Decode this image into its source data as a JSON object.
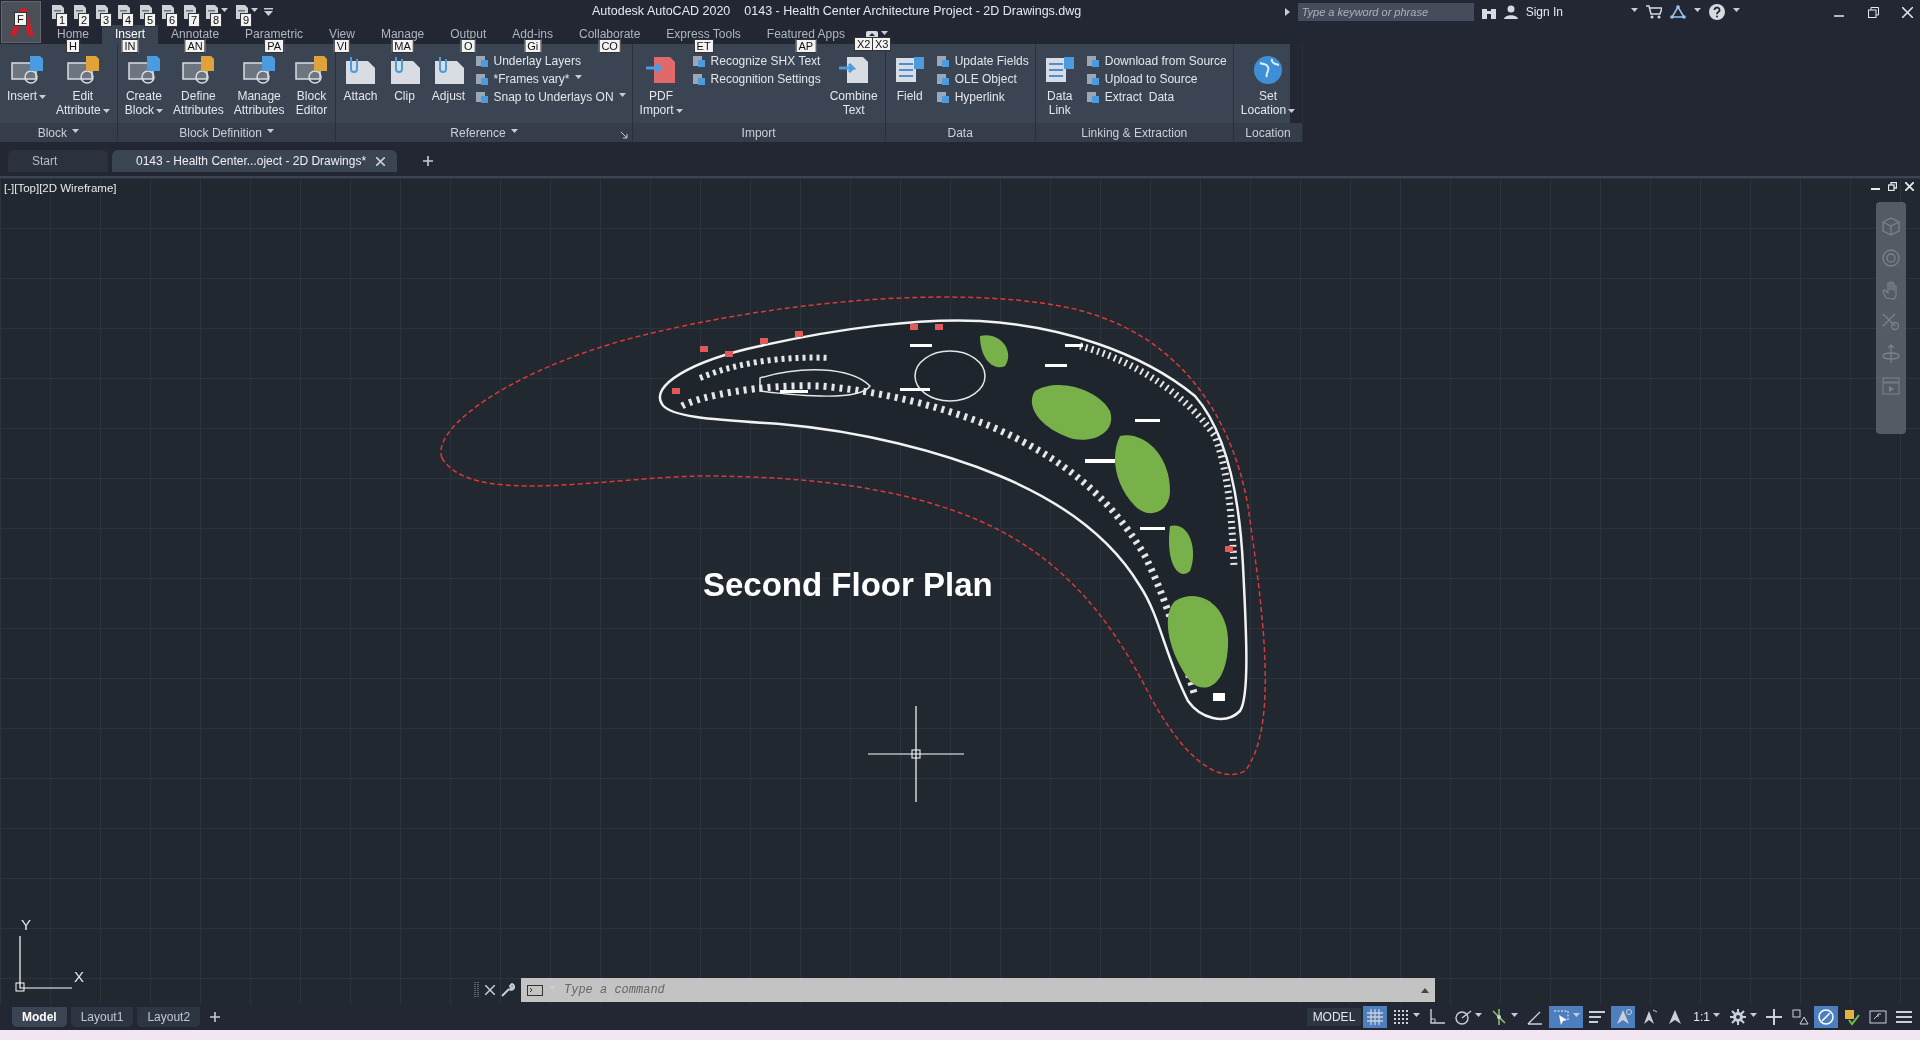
{
  "app_button": {
    "keytip": "F"
  },
  "quick_access": [
    {
      "keytip": "1",
      "has_menu": false
    },
    {
      "keytip": "2",
      "has_menu": false
    },
    {
      "keytip": "3",
      "has_menu": false
    },
    {
      "keytip": "4",
      "has_menu": false
    },
    {
      "keytip": "5",
      "has_menu": false
    },
    {
      "keytip": "6",
      "has_menu": false
    },
    {
      "keytip": "7",
      "has_menu": false
    },
    {
      "keytip": "8",
      "has_menu": true
    },
    {
      "keytip": "9",
      "has_menu": true
    }
  ],
  "window": {
    "app_name": "Autodesk AutoCAD 2020",
    "document_name": "0143 - Health Center Architecture Project - 2D Drawings.dwg"
  },
  "search": {
    "placeholder": "Type a keyword or phrase"
  },
  "sign_in": "Sign In",
  "ribbon_tabs": [
    {
      "label": "Home",
      "keytip": "H",
      "selected": false
    },
    {
      "label": "Insert",
      "keytip": "IN",
      "selected": true
    },
    {
      "label": "Annotate",
      "keytip": "AN",
      "selected": false
    },
    {
      "label": "Parametric",
      "keytip": "PA",
      "selected": false
    },
    {
      "label": "View",
      "keytip": "VI",
      "selected": false
    },
    {
      "label": "Manage",
      "keytip": "MA",
      "selected": false
    },
    {
      "label": "Output",
      "keytip": "O",
      "selected": false
    },
    {
      "label": "Add-ins",
      "keytip": "Gi",
      "selected": false
    },
    {
      "label": "Collaborate",
      "keytip": "CO",
      "selected": false
    },
    {
      "label": "Express Tools",
      "keytip": "ET",
      "selected": false
    },
    {
      "label": "Featured Apps",
      "keytip": "AP",
      "selected": false
    }
  ],
  "workspace_menu": {
    "keytips": [
      "X2",
      "X3"
    ]
  },
  "ribbon_panels": [
    {
      "title": "Block",
      "has_menu": true,
      "has_launcher": false,
      "tools": [
        {
          "kind": "large",
          "lines": [
            "Insert"
          ],
          "has_menu": true
        },
        {
          "kind": "large",
          "lines": [
            "Edit",
            "Attribute"
          ],
          "has_menu": true
        }
      ]
    },
    {
      "title": "Block Definition",
      "has_menu": true,
      "has_launcher": false,
      "tools": [
        {
          "kind": "large",
          "lines": [
            "Create",
            "Block"
          ],
          "has_menu": true
        },
        {
          "kind": "large",
          "lines": [
            "Define",
            "Attributes"
          ],
          "has_menu": false
        },
        {
          "kind": "large",
          "lines": [
            "Manage",
            "Attributes"
          ],
          "has_menu": false
        },
        {
          "kind": "large",
          "lines": [
            "Block",
            "Editor"
          ],
          "has_menu": false
        }
      ]
    },
    {
      "title": "Reference",
      "has_menu": true,
      "has_launcher": true,
      "tools": [
        {
          "kind": "large",
          "lines": [
            "Attach"
          ],
          "has_menu": false
        },
        {
          "kind": "large",
          "lines": [
            "Clip"
          ],
          "has_menu": false
        },
        {
          "kind": "large",
          "lines": [
            "Adjust"
          ],
          "has_menu": false
        },
        {
          "kind": "small",
          "label": "Underlay Layers",
          "has_menu": false
        },
        {
          "kind": "small",
          "label": "*Frames vary*",
          "has_menu": true
        },
        {
          "kind": "small",
          "label": "Snap to Underlays ON",
          "has_menu": true
        }
      ]
    },
    {
      "title": "Import",
      "has_menu": false,
      "has_launcher": false,
      "tools": [
        {
          "kind": "large",
          "lines": [
            "PDF",
            "Import"
          ],
          "has_menu": true
        },
        {
          "kind": "small",
          "label": "Recognize SHX Text",
          "has_menu": false
        },
        {
          "kind": "small",
          "label": "Recognition Settings",
          "has_menu": false
        },
        {
          "kind": "large",
          "lines": [
            "Combine",
            "Text"
          ],
          "has_menu": false
        }
      ]
    },
    {
      "title": "Data",
      "has_menu": false,
      "has_launcher": false,
      "tools": [
        {
          "kind": "large",
          "lines": [
            "Field"
          ],
          "has_menu": false
        },
        {
          "kind": "small",
          "label": "Update Fields",
          "has_menu": false
        },
        {
          "kind": "small",
          "label": "OLE Object",
          "has_menu": false
        },
        {
          "kind": "small",
          "label": "Hyperlink",
          "has_menu": false
        }
      ]
    },
    {
      "title": "Linking & Extraction",
      "has_menu": false,
      "has_launcher": false,
      "tools": [
        {
          "kind": "large",
          "lines": [
            "Data",
            "Link"
          ],
          "has_menu": false
        },
        {
          "kind": "small",
          "label": "Download from Source",
          "has_menu": false
        },
        {
          "kind": "small",
          "label": "Upload to Source",
          "has_menu": false
        },
        {
          "kind": "small",
          "label": "Extract  Data",
          "has_menu": false
        }
      ]
    },
    {
      "title": "Location",
      "has_menu": false,
      "has_launcher": false,
      "tools": [
        {
          "kind": "large",
          "lines": [
            "Set",
            "Location"
          ],
          "has_menu": true
        }
      ]
    }
  ],
  "document_tabs": [
    {
      "label": "Start",
      "selected": false,
      "closable": false
    },
    {
      "label": "0143 - Health Center...oject - 2D Drawings*",
      "selected": true,
      "closable": true
    }
  ],
  "viewport": {
    "label": "[-][Top][2D Wireframe]",
    "plan_title": "Second Floor Plan",
    "ucs": {
      "x": "X",
      "y": "Y"
    }
  },
  "command_line": {
    "placeholder": "Type a command"
  },
  "layout_tabs": [
    {
      "label": "Model",
      "selected": true
    },
    {
      "label": "Layout1",
      "selected": false
    },
    {
      "label": "Layout2",
      "selected": false
    }
  ],
  "status_bar": {
    "model_label": "MODEL",
    "scale": "1:1",
    "toggles": [
      {
        "kind": "grid",
        "on": true,
        "has_menu": false
      },
      {
        "kind": "snap",
        "on": false,
        "has_menu": true
      },
      {
        "kind": "ortho",
        "on": false,
        "has_menu": false
      },
      {
        "kind": "polar",
        "on": false,
        "has_menu": true
      },
      {
        "kind": "tracking",
        "on": false,
        "has_menu": true
      },
      {
        "kind": "angle",
        "on": false,
        "has_menu": false
      },
      {
        "kind": "selection",
        "on": true,
        "has_menu": true
      },
      {
        "kind": "lineweight",
        "on": false,
        "has_menu": false
      },
      {
        "kind": "annotation",
        "on": true,
        "has_menu": false
      },
      {
        "kind": "autoscale",
        "on": false,
        "has_menu": false
      },
      {
        "kind": "annoscale",
        "on": false,
        "has_menu": false
      }
    ],
    "tools": [
      {
        "kind": "gear",
        "on": false,
        "has_menu": true
      },
      {
        "kind": "plus",
        "on": false,
        "has_menu": false
      },
      {
        "kind": "isolate",
        "on": false,
        "has_menu": false
      },
      {
        "kind": "hardware",
        "on": true,
        "has_menu": false
      },
      {
        "kind": "units",
        "on": false,
        "has_menu": false
      },
      {
        "kind": "fullscreen",
        "on": false,
        "has_menu": false
      },
      {
        "kind": "customize",
        "on": false,
        "has_menu": false
      }
    ]
  }
}
